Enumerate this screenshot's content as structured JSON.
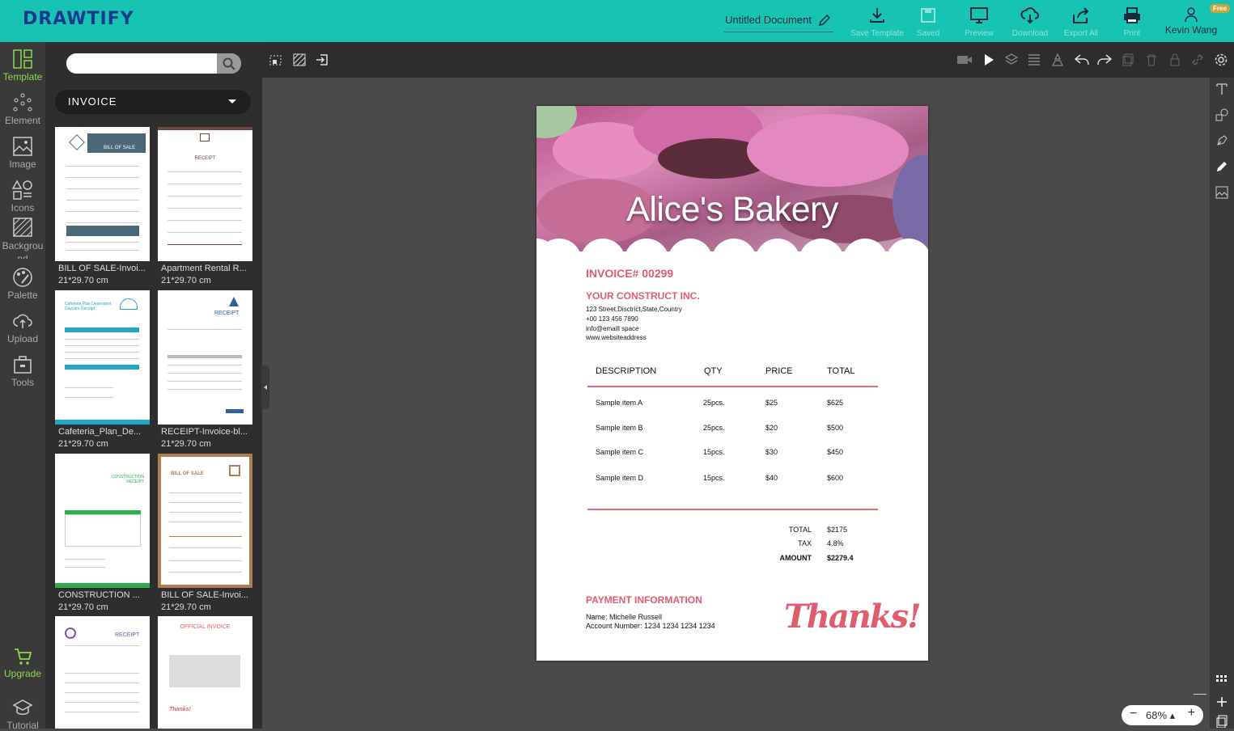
{
  "app": {
    "logo": "DRAWTIFY"
  },
  "header": {
    "doc_title": "Untitled Document",
    "buttons": [
      {
        "label": "Save Template",
        "icon": "download-icon"
      },
      {
        "label": "Saved",
        "icon": "save-icon"
      },
      {
        "label": "Preview",
        "icon": "monitor-icon"
      },
      {
        "label": "Download",
        "icon": "cloud-download-icon"
      },
      {
        "label": "Export All",
        "icon": "share-icon"
      },
      {
        "label": "Print",
        "icon": "printer-icon"
      }
    ],
    "user": {
      "name": "Kevin Wang",
      "badge": "Free"
    }
  },
  "leftnav": {
    "items": [
      {
        "label": "Template"
      },
      {
        "label": "Element"
      },
      {
        "label": "Image"
      },
      {
        "label": "Icons"
      },
      {
        "label": "Backgrou nd"
      },
      {
        "label": "Palette"
      },
      {
        "label": "Upload"
      },
      {
        "label": "Tools"
      },
      {
        "label": "Upgrade"
      },
      {
        "label": "Tutorial"
      }
    ]
  },
  "panel": {
    "search_placeholder": "",
    "category": "INVOICE",
    "templates": [
      {
        "name": "BILL OF SALE-Invoi...",
        "size": "21*29.70 cm",
        "thumb_title": "BILL OF SALE"
      },
      {
        "name": "Apartment Rental R...",
        "size": "21*29.70 cm",
        "thumb_title": "RECEIPT"
      },
      {
        "name": "Cafeteria_Plan_De...",
        "size": "21*29.70 cm",
        "thumb_title": "Cafeteria Plan Dependent Daycare Receipt"
      },
      {
        "name": "RECEIPT-Invoice-bl...",
        "size": "21*29.70 cm",
        "thumb_title": "RECEIPT"
      },
      {
        "name": "CONSTRUCTION ...",
        "size": "21*29.70 cm",
        "thumb_title": "CONSTRUCTION RECEIPT"
      },
      {
        "name": "BILL OF SALE-Invoi...",
        "size": "21*29.70 cm",
        "thumb_title": "BILL OF SALE"
      },
      {
        "name": "",
        "size": "",
        "thumb_title": "RECEIPT"
      },
      {
        "name": "",
        "size": "",
        "thumb_title": "OFFICIAL INVOICE"
      }
    ]
  },
  "invoice": {
    "bakery": "Alice's Bakery",
    "number": "INVOICE# 00299",
    "company": "YOUR CONSTRUCT INC.",
    "address": [
      "123 Street,Disctrict,State,Country",
      "+00 123 456 7890",
      "info@emaill space",
      "www.websiteaddress"
    ],
    "headers": [
      "DESCRIPTION",
      "QTY",
      "PRICE",
      "TOTAL"
    ],
    "rows": [
      [
        "Sample item A",
        "25pcs.",
        "$25",
        "$625"
      ],
      [
        "Sample item B",
        "25pcs.",
        "$20",
        "$500"
      ],
      [
        "Sample item C",
        "15pcs.",
        "$30",
        "$450"
      ],
      [
        "Sample item D",
        "15pcs.",
        "$40",
        "$600"
      ]
    ],
    "totals": [
      {
        "label": "TOTAL",
        "value": "$2175"
      },
      {
        "label": "TAX",
        "value": "4.8%"
      },
      {
        "label": "AMOUNT",
        "value": "$2279.4"
      }
    ],
    "payment_title": "PAYMENT INFORMATION",
    "payment_name": "Name: Michelle Russell",
    "payment_account": "Account Number: 1234 1234 1234 1234",
    "thanks": "Thanks!"
  },
  "zoom": {
    "value": "68% ▴",
    "minus": "−",
    "plus": "+"
  },
  "colors": {
    "brand": "#17c3b2",
    "accent": "#e05d6e",
    "active": "#8bd94a"
  }
}
